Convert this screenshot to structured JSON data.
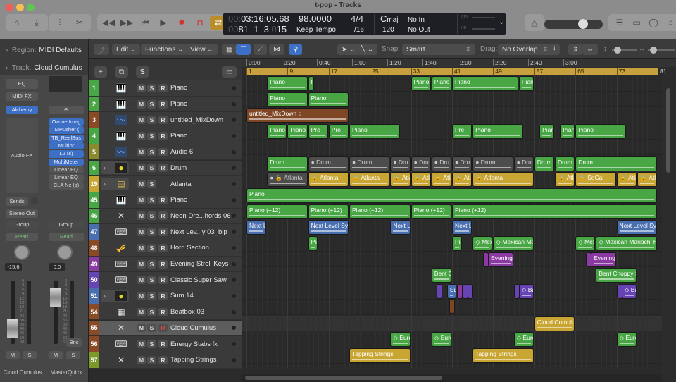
{
  "window": {
    "title": "t-pop - Tracks",
    "traffic_lights": [
      "#ee5f58",
      "#f5be4f",
      "#5fc653"
    ]
  },
  "toolbar": {
    "left_icons": [
      "inbox-icon",
      "download-icon",
      "mixer-icon",
      "scissors-icon"
    ],
    "transport": [
      "rewind-icon",
      "fast-forward-icon",
      "go-to-start-icon",
      "play-icon",
      "record-icon",
      "capture-record-icon",
      "cycle-icon"
    ],
    "right_icons": [
      "metronome-icon",
      "list-editors-icon",
      "notepad-icon",
      "loop-browser-icon",
      "media-browser-icon"
    ],
    "master_volume_fraction": 0.7
  },
  "lcd": {
    "time_prefix": "00:",
    "time": "03:16:05.68",
    "bar_prefix": "00",
    "bar": "81  1  3",
    "tick_prefix": "0",
    "tick": "15",
    "tempo": "98.0000",
    "tempo_mode": "Keep Tempo",
    "signature": "4/4",
    "division": "/16",
    "key": "C",
    "key_mode": "maj",
    "key_extra": "120",
    "midi_in": "No In",
    "midi_out": "No Out",
    "cpu_label": "CPU",
    "hd_label": "HD"
  },
  "inspector": {
    "region_label": "Region:",
    "region_value": "MIDI Defaults",
    "track_label": "Track:",
    "track_value": "Cloud Cumulus"
  },
  "channel_strips": [
    {
      "name": "Cloud Cumulus",
      "eq": "EQ",
      "midi_fx": "MIDI FX",
      "instrument": "Alchemy",
      "audio_fx_label": "Audio FX",
      "sends": "Sends",
      "output": "Stereo Out",
      "group": "Group",
      "automation": "Read",
      "volume": "-15.6",
      "mute": "M",
      "solo": "S"
    },
    {
      "name": "MasterQuick",
      "plugins": [
        "Ozone Imag",
        "IMPusher (",
        "TB_ReelBus",
        "Multipr",
        "L2 (s)",
        "MultiMeter",
        "Linear EQ",
        "Linear EQ",
        "CLA Nx (s)"
      ],
      "group": "Group",
      "automation": "Read",
      "volume": "0.0",
      "bounce": "Bnc",
      "mute": "M",
      "solo": "S"
    }
  ],
  "meter_scale": [
    "0",
    "3",
    "6",
    "9",
    "12",
    "15",
    "18",
    "21",
    "24",
    "30",
    "35",
    "40",
    "45",
    "50",
    "60"
  ],
  "edit_toolbar": {
    "menus": [
      "Edit",
      "Functions",
      "View"
    ],
    "snap_label": "Snap:",
    "snap_value": "Smart",
    "drag_label": "Drag:",
    "drag_value": "No Overlap"
  },
  "track_header_buttons": {
    "add": "+",
    "duplicate": "⧉",
    "solo": "S"
  },
  "ruler": {
    "times": [
      "0:00",
      "0:20",
      "0:40",
      "1:00",
      "1:20",
      "1:40",
      "2:00",
      "2:20",
      "2:40",
      "3:00"
    ],
    "bars": [
      "1",
      "9",
      "17",
      "25",
      "33",
      "41",
      "49",
      "57",
      "65",
      "73",
      "81"
    ]
  },
  "tracks": [
    {
      "num": "1",
      "color": "#48a744",
      "icon": "grand-piano-icon",
      "name": "Piano",
      "r": true
    },
    {
      "num": "2",
      "color": "#48a744",
      "icon": "grand-piano-icon",
      "name": "Piano",
      "r": true
    },
    {
      "num": "3",
      "color": "#8a4a26",
      "icon": "audio-waveform-icon",
      "name": "untitled_MixDown",
      "r": true
    },
    {
      "num": "4",
      "color": "#48a744",
      "icon": "grand-piano-icon",
      "name": "Piano",
      "r": true
    },
    {
      "num": "5",
      "color": "#8a8a2c",
      "icon": "audio-waveform-icon",
      "name": "Audio 6",
      "r": true
    },
    {
      "num": "6",
      "color": "#48a744",
      "icon": "drummer-icon",
      "name": "Drum",
      "r": true,
      "folder": true
    },
    {
      "num": "19",
      "color": "#c9a633",
      "icon": "pattern-icon",
      "name": "Atlanta",
      "r": false,
      "folder": true
    },
    {
      "num": "45",
      "color": "#48a744",
      "icon": "grand-piano-icon",
      "name": "Piano",
      "r": true
    },
    {
      "num": "46",
      "color": "#48a744",
      "icon": "keyboard-stand-icon",
      "name": "Neon Dre...hords 06",
      "r": true
    },
    {
      "num": "47",
      "color": "#4a6fb0",
      "icon": "synth-icon",
      "name": "Next Lev...y 03_bip",
      "r": true
    },
    {
      "num": "48",
      "color": "#8a4a26",
      "icon": "horn-icon",
      "name": "Horn Section",
      "r": true
    },
    {
      "num": "49",
      "color": "#8a3aa0",
      "icon": "synth-icon",
      "name": "Evening Stroll Keys",
      "r": true
    },
    {
      "num": "50",
      "color": "#6644b4",
      "icon": "synth-icon",
      "name": "Classic Super Saw",
      "r": true
    },
    {
      "num": "51",
      "color": "#4a6fb0",
      "icon": "drummer-icon",
      "name": "Sum 14",
      "r": true,
      "folder": true
    },
    {
      "num": "54",
      "color": "#8a4a26",
      "icon": "drum-machine-icon",
      "name": "Beatbox 03",
      "r": true
    },
    {
      "num": "55",
      "color": "#8a4a26",
      "icon": "keyboard-stand-icon",
      "name": "Cloud Cumulus",
      "r": true,
      "selected": true
    },
    {
      "num": "56",
      "color": "#8a4a26",
      "icon": "synth-icon",
      "name": "Energy Stabs fx",
      "r": true
    },
    {
      "num": "57",
      "color": "#7a9a2c",
      "icon": "keyboard-stand-icon",
      "name": "Tapping Strings",
      "r": true
    }
  ],
  "regions": [
    {
      "row": 0,
      "start": 5,
      "end": 13,
      "label": "Piano",
      "c": "g"
    },
    {
      "row": 0,
      "start": 13,
      "end": 14,
      "label": "Pia",
      "c": "g"
    },
    {
      "row": 0,
      "start": 33,
      "end": 37,
      "label": "Piano",
      "c": "g"
    },
    {
      "row": 0,
      "start": 37,
      "end": 41,
      "label": "Piano",
      "c": "g"
    },
    {
      "row": 0,
      "start": 41,
      "end": 54,
      "label": "Piano",
      "c": "g"
    },
    {
      "row": 0,
      "start": 54,
      "end": 57,
      "label": "Pian",
      "c": "g"
    },
    {
      "row": 1,
      "start": 5,
      "end": 13,
      "label": "Piano",
      "c": "g"
    },
    {
      "row": 1,
      "start": 13,
      "end": 21,
      "label": "Piano",
      "c": "g"
    },
    {
      "row": 2,
      "start": 1,
      "end": 21,
      "label": "untitled_MixDown  ○",
      "c": "br"
    },
    {
      "row": 3,
      "start": 5,
      "end": 9,
      "label": "Piano",
      "c": "g"
    },
    {
      "row": 3,
      "start": 9,
      "end": 13,
      "label": "Piano",
      "c": "g"
    },
    {
      "row": 3,
      "start": 13,
      "end": 17,
      "label": "Pre",
      "c": "g"
    },
    {
      "row": 3,
      "start": 17,
      "end": 21,
      "label": "Pre",
      "c": "g"
    },
    {
      "row": 3,
      "start": 21,
      "end": 31,
      "label": "Piano",
      "c": "g"
    },
    {
      "row": 3,
      "start": 41,
      "end": 45,
      "label": "Pre",
      "c": "g"
    },
    {
      "row": 3,
      "start": 45,
      "end": 55,
      "label": "Piano",
      "c": "g"
    },
    {
      "row": 3,
      "start": 58,
      "end": 61,
      "label": "Pian",
      "c": "g"
    },
    {
      "row": 3,
      "start": 62,
      "end": 65,
      "label": "Pian",
      "c": "g"
    },
    {
      "row": 3,
      "start": 65,
      "end": 75,
      "label": "Piano",
      "c": "g"
    },
    {
      "row": 5,
      "start": 5,
      "end": 13,
      "label": "Drum",
      "c": "g"
    },
    {
      "row": 5,
      "start": 13,
      "end": 21,
      "label": "● Drum",
      "c": "gr"
    },
    {
      "row": 5,
      "start": 21,
      "end": 29,
      "label": "● Drum",
      "c": "gr"
    },
    {
      "row": 5,
      "start": 29,
      "end": 33,
      "label": "● Dru",
      "c": "gr"
    },
    {
      "row": 5,
      "start": 33,
      "end": 37,
      "label": "● Dru",
      "c": "gr"
    },
    {
      "row": 5,
      "start": 37,
      "end": 41,
      "label": "● Dru",
      "c": "gr"
    },
    {
      "row": 5,
      "start": 41,
      "end": 45,
      "label": "● Dru",
      "c": "gr"
    },
    {
      "row": 5,
      "start": 45,
      "end": 53,
      "label": "● Drum",
      "c": "gr"
    },
    {
      "row": 5,
      "start": 53,
      "end": 57,
      "label": "● Dru",
      "c": "gr"
    },
    {
      "row": 5,
      "start": 57,
      "end": 61,
      "label": "Drum",
      "c": "g"
    },
    {
      "row": 5,
      "start": 61,
      "end": 65,
      "label": "Drum",
      "c": "g"
    },
    {
      "row": 5,
      "start": 65,
      "end": 81,
      "label": "Drum",
      "c": "g"
    },
    {
      "row": 6,
      "start": 5,
      "end": 13,
      "label": "● 🔒 Atlanta",
      "c": "gr"
    },
    {
      "row": 6,
      "start": 13,
      "end": 21,
      "label": "🔒 Atlanta",
      "c": "y"
    },
    {
      "row": 6,
      "start": 21,
      "end": 29,
      "label": "🔒 Atlanta",
      "c": "y"
    },
    {
      "row": 6,
      "start": 29,
      "end": 33,
      "label": "🔒 Atla",
      "c": "y"
    },
    {
      "row": 6,
      "start": 33,
      "end": 37,
      "label": "🔒 Atla",
      "c": "y"
    },
    {
      "row": 6,
      "start": 37,
      "end": 41,
      "label": "🔒 Atla",
      "c": "y"
    },
    {
      "row": 6,
      "start": 41,
      "end": 45,
      "label": "🔒 Atla",
      "c": "y"
    },
    {
      "row": 6,
      "start": 45,
      "end": 57,
      "label": "🔒 Atlanta",
      "c": "y"
    },
    {
      "row": 6,
      "start": 61,
      "end": 65,
      "label": "🔒 Atla",
      "c": "y"
    },
    {
      "row": 6,
      "start": 65,
      "end": 73,
      "label": "🔒 SoCal",
      "c": "y"
    },
    {
      "row": 6,
      "start": 73,
      "end": 77,
      "label": "🔒 Atla",
      "c": "y"
    },
    {
      "row": 6,
      "start": 77,
      "end": 81,
      "label": "🔒 Atla",
      "c": "y"
    },
    {
      "row": 7,
      "start": 1,
      "end": 81,
      "label": "Piano",
      "c": "g"
    },
    {
      "row": 8,
      "start": 1,
      "end": 13,
      "label": "Piano (+12)",
      "c": "g"
    },
    {
      "row": 8,
      "start": 13,
      "end": 21,
      "label": "Piano (+12)",
      "c": "g"
    },
    {
      "row": 8,
      "start": 21,
      "end": 33,
      "label": "Piano (+12)",
      "c": "g"
    },
    {
      "row": 8,
      "start": 33,
      "end": 41,
      "label": "Piano (+12)",
      "c": "g"
    },
    {
      "row": 8,
      "start": 41,
      "end": 81,
      "label": "Piano (+12)",
      "c": "g"
    },
    {
      "row": 9,
      "start": 1,
      "end": 5,
      "label": "Next L",
      "c": "b"
    },
    {
      "row": 9,
      "start": 13,
      "end": 21,
      "label": "Next Level Synt",
      "c": "b"
    },
    {
      "row": 9,
      "start": 29,
      "end": 33,
      "label": "Next L",
      "c": "b"
    },
    {
      "row": 9,
      "start": 41,
      "end": 45,
      "label": "Next L",
      "c": "b"
    },
    {
      "row": 9,
      "start": 73,
      "end": 81,
      "label": "Next Level Syn",
      "c": "b"
    },
    {
      "row": 10,
      "start": 13,
      "end": 15,
      "label": "Pia",
      "c": "g"
    },
    {
      "row": 10,
      "start": 41,
      "end": 43,
      "label": "Pia",
      "c": "g"
    },
    {
      "row": 10,
      "start": 45,
      "end": 49,
      "label": "◇ Mexi",
      "c": "g"
    },
    {
      "row": 10,
      "start": 49,
      "end": 57,
      "label": "◇ Mexican Mari",
      "c": "g"
    },
    {
      "row": 10,
      "start": 65,
      "end": 69,
      "label": "◇ Mexi",
      "c": "g"
    },
    {
      "row": 10,
      "start": 69,
      "end": 81,
      "label": "◇ Mexican Mariachi Hor",
      "c": "g"
    },
    {
      "row": 11,
      "start": 47,
      "end": 48,
      "label": "",
      "c": "p"
    },
    {
      "row": 11,
      "start": 48,
      "end": 53,
      "label": "Evening Str",
      "c": "p"
    },
    {
      "row": 11,
      "start": 67,
      "end": 68,
      "label": "",
      "c": "p"
    },
    {
      "row": 11,
      "start": 68,
      "end": 73,
      "label": "Evening Str",
      "c": "p"
    },
    {
      "row": 12,
      "start": 37,
      "end": 41,
      "label": "Bent C",
      "c": "g"
    },
    {
      "row": 12,
      "start": 69,
      "end": 77,
      "label": "Bent Choppy S",
      "c": "g"
    },
    {
      "row": 13,
      "start": 38,
      "end": 39,
      "label": "",
      "c": "v"
    },
    {
      "row": 13,
      "start": 40,
      "end": 42,
      "label": "Su",
      "c": "b"
    },
    {
      "row": 13,
      "start": 42,
      "end": 43,
      "label": "",
      "c": "p"
    },
    {
      "row": 13,
      "start": 43,
      "end": 44,
      "label": "",
      "c": "v"
    },
    {
      "row": 13,
      "start": 44,
      "end": 45,
      "label": "",
      "c": "v"
    },
    {
      "row": 13,
      "start": 53,
      "end": 54,
      "label": "",
      "c": "v"
    },
    {
      "row": 13,
      "start": 54,
      "end": 57,
      "label": "◇ Bail",
      "c": "v"
    },
    {
      "row": 13,
      "start": 73,
      "end": 74,
      "label": "",
      "c": "v"
    },
    {
      "row": 13,
      "start": 74,
      "end": 77,
      "label": "◇ Bail",
      "c": "v"
    },
    {
      "row": 14,
      "start": 40.5,
      "end": 41.5,
      "label": "",
      "c": "br"
    },
    {
      "row": 15,
      "start": 57,
      "end": 65,
      "label": "Cloud Cumulus",
      "c": "y"
    },
    {
      "row": 16,
      "start": 29,
      "end": 33,
      "label": "◇ Euro",
      "c": "g"
    },
    {
      "row": 16,
      "start": 37,
      "end": 41,
      "label": "◇ Euro",
      "c": "g"
    },
    {
      "row": 16,
      "start": 53,
      "end": 57,
      "label": "◇ Euro",
      "c": "g"
    },
    {
      "row": 16,
      "start": 73,
      "end": 77,
      "label": "◇ Euro",
      "c": "g"
    },
    {
      "row": 17,
      "start": 21,
      "end": 33,
      "label": "Tapping Strings",
      "c": "y"
    },
    {
      "row": 17,
      "start": 45,
      "end": 57,
      "label": "Tapping Strings",
      "c": "y"
    }
  ],
  "playhead_bar": 81
}
